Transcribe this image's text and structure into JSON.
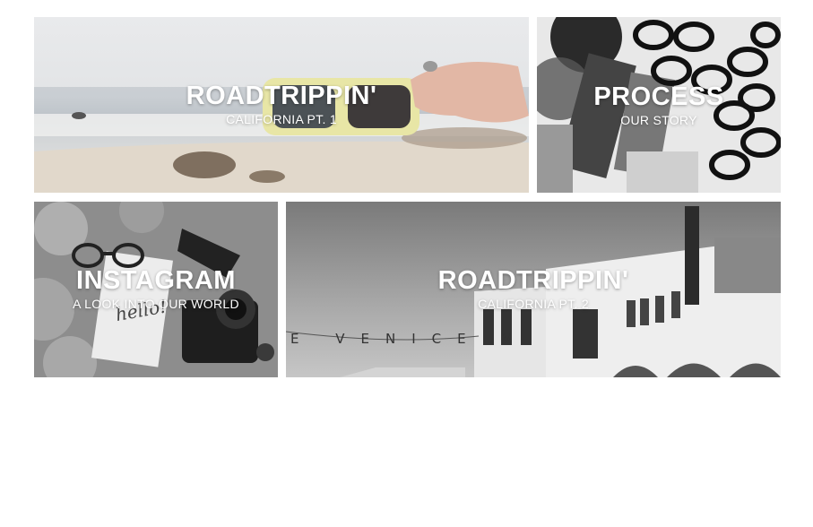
{
  "tiles": [
    {
      "title": "ROADTRIPPIN'",
      "subtitle": "CALIFORNIA PT. 1"
    },
    {
      "title": "PROCESS",
      "subtitle": "OUR STORY"
    },
    {
      "title": "INSTAGRAM",
      "subtitle": "A LOOK INTO OUR WORLD"
    },
    {
      "title": "ROADTRIPPIN'",
      "subtitle": "CALIFORNIA PT. 2"
    }
  ],
  "images": {
    "tile_1": "beach-sunglasses-photo",
    "tile_2": "eyeglass-frames-photo",
    "tile_3": "sunglasses-camera-flatlay-photo",
    "tile_4": "venice-building-photo"
  },
  "colors": {
    "background": "#ffffff",
    "caption_text": "#ffffff",
    "frame_yellow": "#e8e6a6"
  }
}
